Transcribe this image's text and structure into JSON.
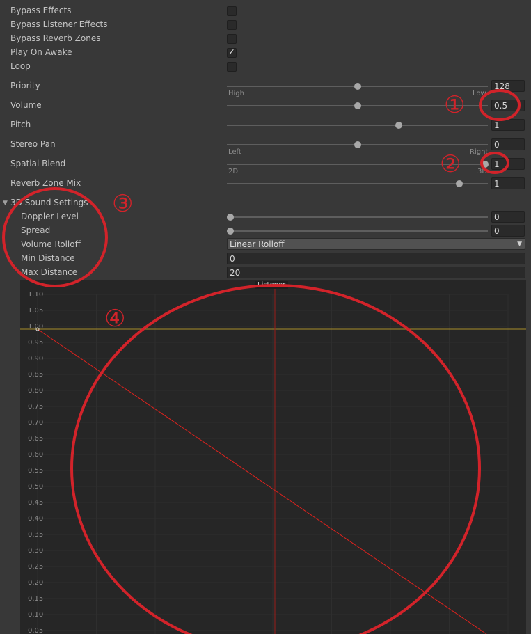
{
  "properties": {
    "bypass_effects": {
      "label": "Bypass Effects",
      "checked": false
    },
    "bypass_listener_effects": {
      "label": "Bypass Listener Effects",
      "checked": false
    },
    "bypass_reverb_zones": {
      "label": "Bypass Reverb Zones",
      "checked": false
    },
    "play_on_awake": {
      "label": "Play On Awake",
      "checked": true
    },
    "loop": {
      "label": "Loop",
      "checked": false
    },
    "priority": {
      "label": "Priority",
      "value": "128",
      "min_label": "High",
      "max_label": "Low",
      "fraction": 0.5
    },
    "volume": {
      "label": "Volume",
      "value": "0.5",
      "fraction": 0.5
    },
    "pitch": {
      "label": "Pitch",
      "value": "1",
      "fraction": 0.66
    },
    "stereo_pan": {
      "label": "Stereo Pan",
      "value": "0",
      "min_label": "Left",
      "max_label": "Right",
      "fraction": 0.5
    },
    "spatial_blend": {
      "label": "Spatial Blend",
      "value": "1",
      "min_label": "2D",
      "max_label": "3D",
      "fraction": 1.0
    },
    "reverb_zone_mix": {
      "label": "Reverb Zone Mix",
      "value": "1",
      "fraction": 0.9
    }
  },
  "sound_3d": {
    "title": "3D Sound Settings",
    "doppler_level": {
      "label": "Doppler Level",
      "value": "0",
      "fraction": 0.0
    },
    "spread": {
      "label": "Spread",
      "value": "0",
      "fraction": 0.0
    },
    "volume_rolloff": {
      "label": "Volume Rolloff",
      "value": "Linear Rolloff"
    },
    "min_distance": {
      "label": "Min Distance",
      "value": "0"
    },
    "max_distance": {
      "label": "Max Distance",
      "value": "20"
    }
  },
  "graph": {
    "listener_label": "Listener",
    "y_ticks": [
      "1.10",
      "1.05",
      "1.00",
      "0.95",
      "0.90",
      "0.85",
      "0.80",
      "0.75",
      "0.70",
      "0.65",
      "0.60",
      "0.55",
      "0.50",
      "0.45",
      "0.40",
      "0.35",
      "0.30",
      "0.25",
      "0.20",
      "0.15",
      "0.10",
      "0.05"
    ]
  },
  "annotations": [
    "①",
    "②",
    "③",
    "④"
  ],
  "colors": {
    "background": "#383838",
    "field": "#2a2a2a",
    "annotation_red": "#d2232a",
    "rolloff_line": "#e0221d",
    "listener_line": "#9a1f1a",
    "reference_line": "#a88f2a"
  }
}
